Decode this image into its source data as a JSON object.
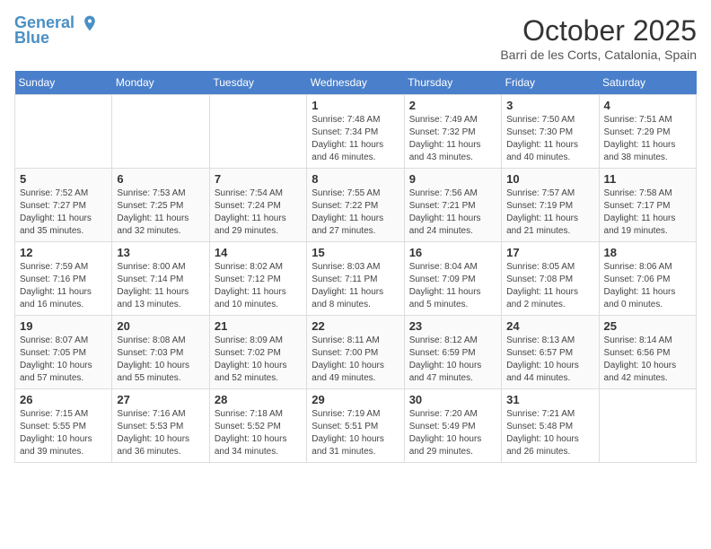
{
  "header": {
    "logo_line1": "General",
    "logo_line2": "Blue",
    "month_title": "October 2025",
    "subtitle": "Barri de les Corts, Catalonia, Spain"
  },
  "days_of_week": [
    "Sunday",
    "Monday",
    "Tuesday",
    "Wednesday",
    "Thursday",
    "Friday",
    "Saturday"
  ],
  "weeks": [
    [
      {
        "day": "",
        "info": ""
      },
      {
        "day": "",
        "info": ""
      },
      {
        "day": "",
        "info": ""
      },
      {
        "day": "1",
        "info": "Sunrise: 7:48 AM\nSunset: 7:34 PM\nDaylight: 11 hours and 46 minutes."
      },
      {
        "day": "2",
        "info": "Sunrise: 7:49 AM\nSunset: 7:32 PM\nDaylight: 11 hours and 43 minutes."
      },
      {
        "day": "3",
        "info": "Sunrise: 7:50 AM\nSunset: 7:30 PM\nDaylight: 11 hours and 40 minutes."
      },
      {
        "day": "4",
        "info": "Sunrise: 7:51 AM\nSunset: 7:29 PM\nDaylight: 11 hours and 38 minutes."
      }
    ],
    [
      {
        "day": "5",
        "info": "Sunrise: 7:52 AM\nSunset: 7:27 PM\nDaylight: 11 hours and 35 minutes."
      },
      {
        "day": "6",
        "info": "Sunrise: 7:53 AM\nSunset: 7:25 PM\nDaylight: 11 hours and 32 minutes."
      },
      {
        "day": "7",
        "info": "Sunrise: 7:54 AM\nSunset: 7:24 PM\nDaylight: 11 hours and 29 minutes."
      },
      {
        "day": "8",
        "info": "Sunrise: 7:55 AM\nSunset: 7:22 PM\nDaylight: 11 hours and 27 minutes."
      },
      {
        "day": "9",
        "info": "Sunrise: 7:56 AM\nSunset: 7:21 PM\nDaylight: 11 hours and 24 minutes."
      },
      {
        "day": "10",
        "info": "Sunrise: 7:57 AM\nSunset: 7:19 PM\nDaylight: 11 hours and 21 minutes."
      },
      {
        "day": "11",
        "info": "Sunrise: 7:58 AM\nSunset: 7:17 PM\nDaylight: 11 hours and 19 minutes."
      }
    ],
    [
      {
        "day": "12",
        "info": "Sunrise: 7:59 AM\nSunset: 7:16 PM\nDaylight: 11 hours and 16 minutes."
      },
      {
        "day": "13",
        "info": "Sunrise: 8:00 AM\nSunset: 7:14 PM\nDaylight: 11 hours and 13 minutes."
      },
      {
        "day": "14",
        "info": "Sunrise: 8:02 AM\nSunset: 7:12 PM\nDaylight: 11 hours and 10 minutes."
      },
      {
        "day": "15",
        "info": "Sunrise: 8:03 AM\nSunset: 7:11 PM\nDaylight: 11 hours and 8 minutes."
      },
      {
        "day": "16",
        "info": "Sunrise: 8:04 AM\nSunset: 7:09 PM\nDaylight: 11 hours and 5 minutes."
      },
      {
        "day": "17",
        "info": "Sunrise: 8:05 AM\nSunset: 7:08 PM\nDaylight: 11 hours and 2 minutes."
      },
      {
        "day": "18",
        "info": "Sunrise: 8:06 AM\nSunset: 7:06 PM\nDaylight: 11 hours and 0 minutes."
      }
    ],
    [
      {
        "day": "19",
        "info": "Sunrise: 8:07 AM\nSunset: 7:05 PM\nDaylight: 10 hours and 57 minutes."
      },
      {
        "day": "20",
        "info": "Sunrise: 8:08 AM\nSunset: 7:03 PM\nDaylight: 10 hours and 55 minutes."
      },
      {
        "day": "21",
        "info": "Sunrise: 8:09 AM\nSunset: 7:02 PM\nDaylight: 10 hours and 52 minutes."
      },
      {
        "day": "22",
        "info": "Sunrise: 8:11 AM\nSunset: 7:00 PM\nDaylight: 10 hours and 49 minutes."
      },
      {
        "day": "23",
        "info": "Sunrise: 8:12 AM\nSunset: 6:59 PM\nDaylight: 10 hours and 47 minutes."
      },
      {
        "day": "24",
        "info": "Sunrise: 8:13 AM\nSunset: 6:57 PM\nDaylight: 10 hours and 44 minutes."
      },
      {
        "day": "25",
        "info": "Sunrise: 8:14 AM\nSunset: 6:56 PM\nDaylight: 10 hours and 42 minutes."
      }
    ],
    [
      {
        "day": "26",
        "info": "Sunrise: 7:15 AM\nSunset: 5:55 PM\nDaylight: 10 hours and 39 minutes."
      },
      {
        "day": "27",
        "info": "Sunrise: 7:16 AM\nSunset: 5:53 PM\nDaylight: 10 hours and 36 minutes."
      },
      {
        "day": "28",
        "info": "Sunrise: 7:18 AM\nSunset: 5:52 PM\nDaylight: 10 hours and 34 minutes."
      },
      {
        "day": "29",
        "info": "Sunrise: 7:19 AM\nSunset: 5:51 PM\nDaylight: 10 hours and 31 minutes."
      },
      {
        "day": "30",
        "info": "Sunrise: 7:20 AM\nSunset: 5:49 PM\nDaylight: 10 hours and 29 minutes."
      },
      {
        "day": "31",
        "info": "Sunrise: 7:21 AM\nSunset: 5:48 PM\nDaylight: 10 hours and 26 minutes."
      },
      {
        "day": "",
        "info": ""
      }
    ]
  ]
}
